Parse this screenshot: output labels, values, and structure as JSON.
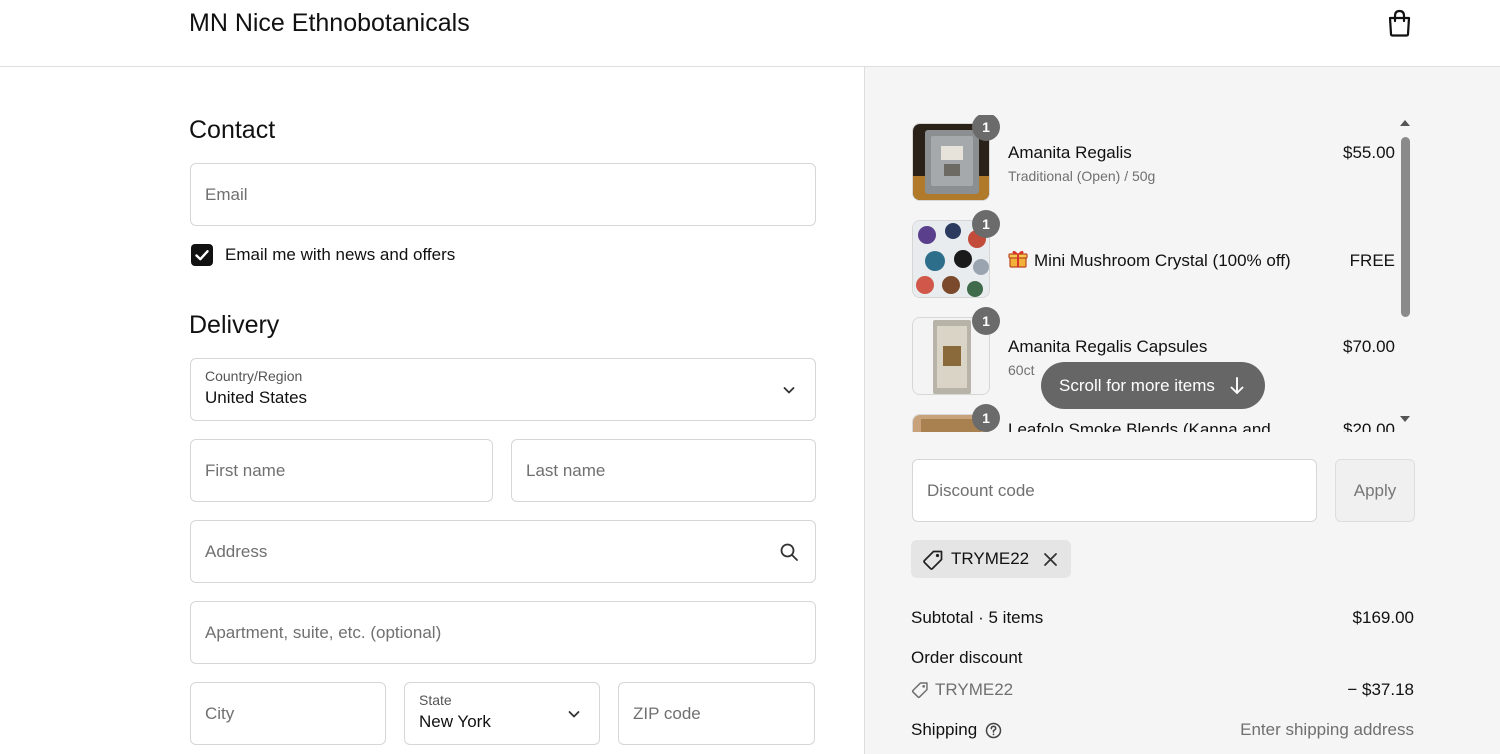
{
  "header": {
    "brand": "MN Nice Ethnobotanicals",
    "cart_icon": "shopping-bag-icon"
  },
  "contact": {
    "heading": "Contact",
    "email_placeholder": "Email",
    "newsletter_label": "Email me with news and offers",
    "newsletter_checked": true
  },
  "delivery": {
    "heading": "Delivery",
    "country_label": "Country/Region",
    "country_value": "United States",
    "first_name_placeholder": "First name",
    "last_name_placeholder": "Last name",
    "address_placeholder": "Address",
    "apartment_placeholder": "Apartment, suite, etc. (optional)",
    "city_placeholder": "City",
    "state_label": "State",
    "state_value": "New York",
    "zip_placeholder": "ZIP code"
  },
  "cart": {
    "items": [
      {
        "qty": "1",
        "name": "Amanita Regalis",
        "variant": "Traditional (Open) / 50g",
        "price": "$55.00"
      },
      {
        "qty": "1",
        "name": "Mini Mushroom Crystal (100% off)",
        "variant": "",
        "price": "FREE",
        "icon": "gift-icon"
      },
      {
        "qty": "1",
        "name": "Amanita Regalis Capsules",
        "variant": "60ct",
        "price": "$70.00"
      },
      {
        "qty": "1",
        "name": "Leafolo Smoke Blends (Kanna and",
        "variant": "",
        "price": "$20.00"
      }
    ],
    "scroll_hint": "Scroll for more items"
  },
  "discount": {
    "placeholder": "Discount code",
    "apply_label": "Apply",
    "applied_code": "TRYME22"
  },
  "summary": {
    "subtotal_label": "Subtotal · 5 items",
    "subtotal_value": "$169.00",
    "order_discount_label": "Order discount",
    "discount_code": "TRYME22",
    "discount_value": "− $37.18",
    "shipping_label": "Shipping",
    "shipping_value": "Enter shipping address"
  },
  "colors": {
    "accent": "#111111",
    "panel_bg": "#f5f5f5",
    "badge_bg": "#6b6b6b",
    "border": "#d6d6d6"
  }
}
